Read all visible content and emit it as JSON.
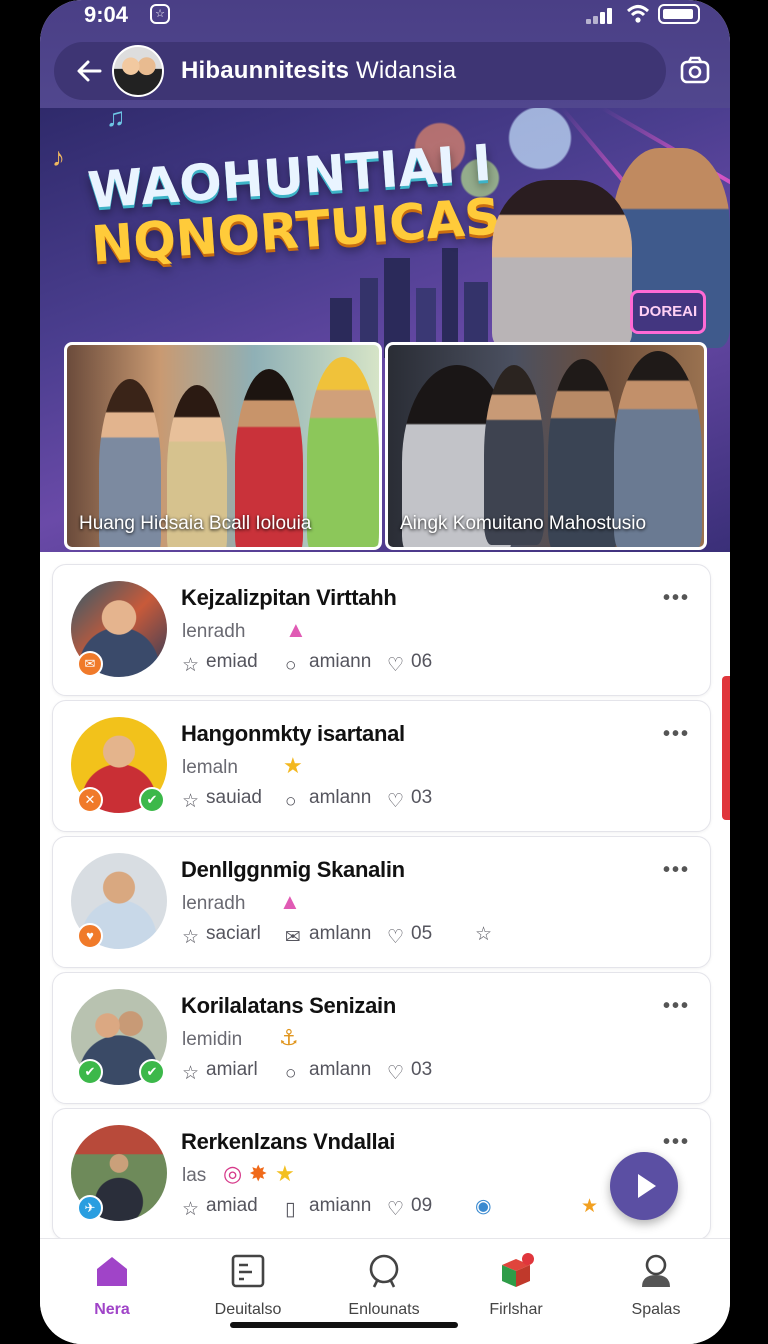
{
  "status": {
    "time": "9:04"
  },
  "header": {
    "title_bold": "Hibaunnitesits",
    "title_rest": "Widansia"
  },
  "hero": {
    "title_line1": "WAOHUNTIAI I",
    "title_line2": "NQNORTUICAS",
    "neon_sign": "DOREAI",
    "photos": [
      {
        "caption": "Huang Hidsaia Bcall Iolouia"
      },
      {
        "caption": "Aingk Komuitano Mahostusio"
      }
    ]
  },
  "list": {
    "items": [
      {
        "name": "Kejzalizpitan Virttahh",
        "sub": "lenradh",
        "meta1": "emiad",
        "meta2": "amiann",
        "meta3": "06",
        "colors": {
          "avatar": "#2c3b5a",
          "badge": "#f07a2a"
        }
      },
      {
        "name": "Hangonmkty isartanal",
        "sub": "lemaln",
        "meta1": "sauiad",
        "meta2": "amlann",
        "meta3": "03",
        "colors": {
          "avatar": "#f2c21b",
          "badge": "#f07a2a",
          "badge2": "#3cb84a"
        }
      },
      {
        "name": "Denllggnmig Skanalin",
        "sub": "lenradh",
        "meta1": "saciarl",
        "meta2": "amlann",
        "meta3": "05",
        "colors": {
          "avatar": "#d8dde2",
          "badge": "#f07a2a"
        }
      },
      {
        "name": "Korilalatans Senizain",
        "sub": "lemidin",
        "meta1": "amiarl",
        "meta2": "amlann",
        "meta3": "03",
        "colors": {
          "avatar": "#b8c2b0",
          "badge": "#3cb84a",
          "badge2": "#3cb84a"
        }
      },
      {
        "name": "Rerkenlzans Vndallai",
        "sub": "las",
        "meta1": "amiad",
        "meta2": "amiann",
        "meta3": "09",
        "colors": {
          "avatar": "#6e8a5a",
          "badge": "#2a9ee0"
        }
      }
    ]
  },
  "nav": {
    "items": [
      {
        "label": "Nera",
        "icon": "home-icon"
      },
      {
        "label": "Deuitalso",
        "icon": "dashboard-icon"
      },
      {
        "label": "Enlounats",
        "icon": "search-icon"
      },
      {
        "label": "Firlshar",
        "icon": "gift-icon"
      },
      {
        "label": "Spalas",
        "icon": "profile-icon"
      }
    ],
    "active": "Nera",
    "accent": "#a044c8"
  }
}
